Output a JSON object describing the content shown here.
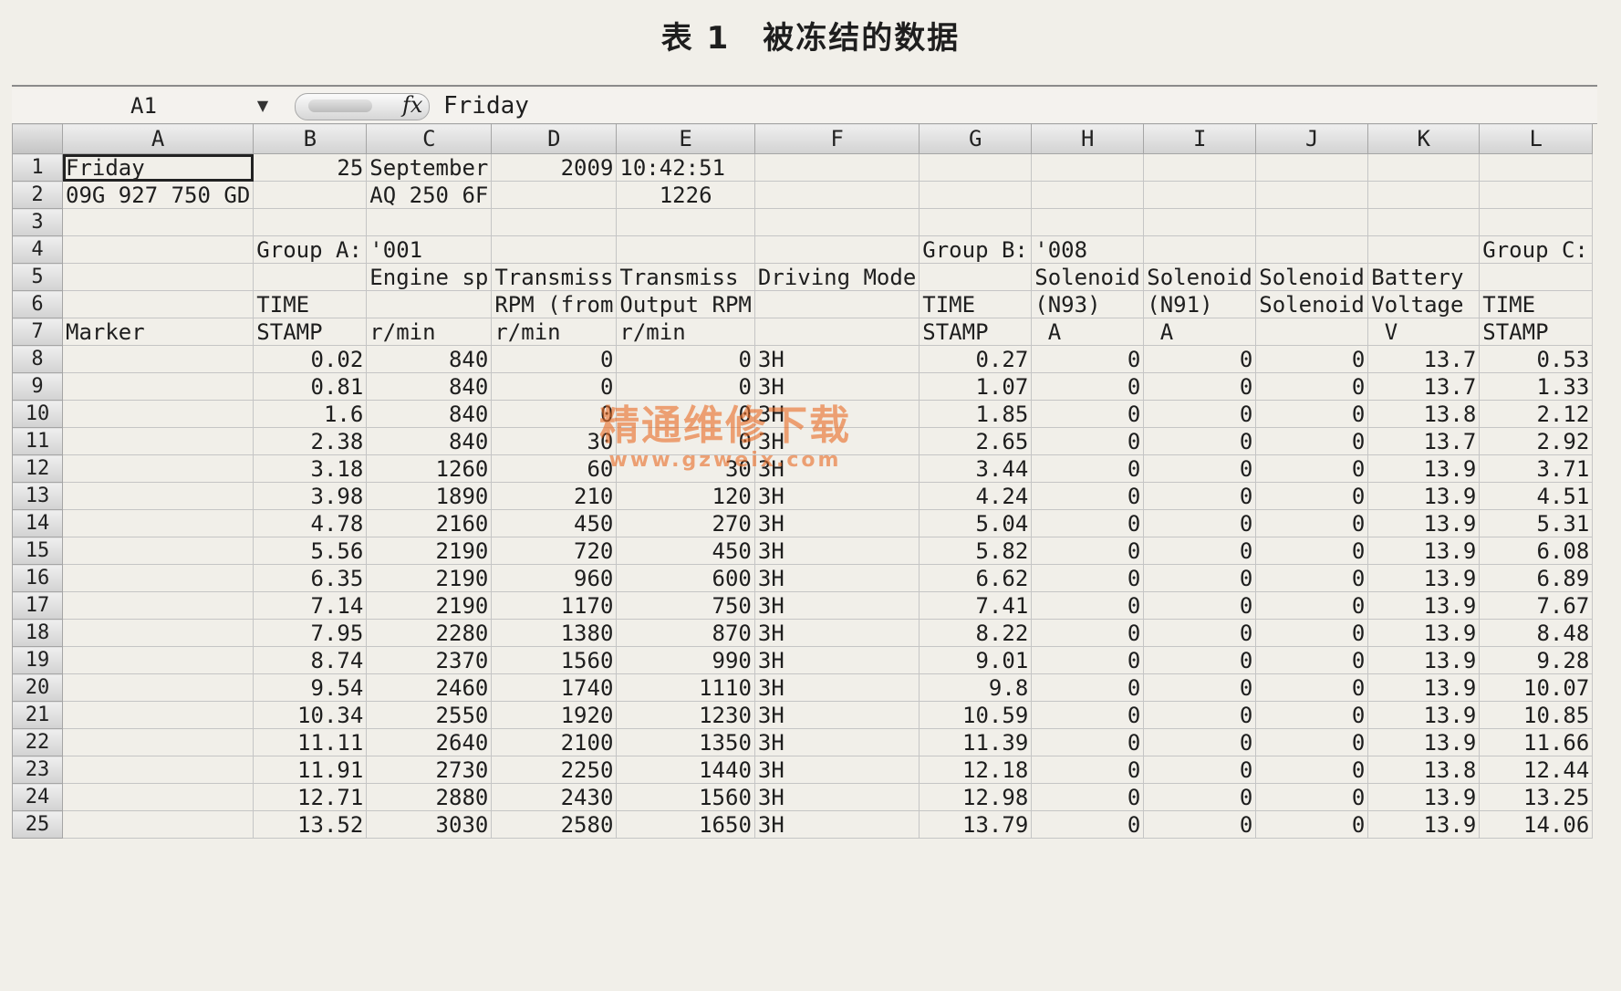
{
  "page_title": "表 1　被冻结的数据",
  "formula_bar": {
    "name_box": "A1",
    "fx_label": "fx",
    "value": "Friday"
  },
  "columns": [
    "A",
    "B",
    "C",
    "D",
    "E",
    "F",
    "G",
    "H",
    "I",
    "J",
    "K",
    "L"
  ],
  "rows": [
    {
      "n": "1",
      "c": [
        {
          "v": "Friday",
          "a": "l",
          "active": true
        },
        {
          "v": "25",
          "a": "r"
        },
        {
          "v": "September",
          "a": "l"
        },
        {
          "v": "2009",
          "a": "r"
        },
        {
          "v": "10:42:51",
          "a": "l"
        },
        {
          "v": ""
        },
        {
          "v": ""
        },
        {
          "v": ""
        },
        {
          "v": ""
        },
        {
          "v": ""
        },
        {
          "v": ""
        },
        {
          "v": ""
        }
      ]
    },
    {
      "n": "2",
      "c": [
        {
          "v": "09G 927 750 GD",
          "a": "l"
        },
        {
          "v": ""
        },
        {
          "v": "AQ 250 6F",
          "a": "l"
        },
        {
          "v": ""
        },
        {
          "v": "1226",
          "a": "c"
        },
        {
          "v": ""
        },
        {
          "v": ""
        },
        {
          "v": ""
        },
        {
          "v": ""
        },
        {
          "v": ""
        },
        {
          "v": ""
        },
        {
          "v": ""
        }
      ]
    },
    {
      "n": "3",
      "c": [
        {
          "v": ""
        },
        {
          "v": ""
        },
        {
          "v": ""
        },
        {
          "v": ""
        },
        {
          "v": ""
        },
        {
          "v": ""
        },
        {
          "v": ""
        },
        {
          "v": ""
        },
        {
          "v": ""
        },
        {
          "v": ""
        },
        {
          "v": ""
        },
        {
          "v": ""
        }
      ]
    },
    {
      "n": "4",
      "c": [
        {
          "v": ""
        },
        {
          "v": "Group A:",
          "a": "l"
        },
        {
          "v": "'001",
          "a": "l"
        },
        {
          "v": ""
        },
        {
          "v": ""
        },
        {
          "v": ""
        },
        {
          "v": "Group B:",
          "a": "l"
        },
        {
          "v": "'008",
          "a": "l"
        },
        {
          "v": ""
        },
        {
          "v": ""
        },
        {
          "v": ""
        },
        {
          "v": "Group C:",
          "a": "l"
        }
      ]
    },
    {
      "n": "5",
      "c": [
        {
          "v": ""
        },
        {
          "v": ""
        },
        {
          "v": "Engine sp",
          "a": "l"
        },
        {
          "v": "Transmiss",
          "a": "l"
        },
        {
          "v": "Transmiss",
          "a": "l"
        },
        {
          "v": "Driving Mode",
          "a": "l"
        },
        {
          "v": ""
        },
        {
          "v": "Solenoid",
          "a": "l"
        },
        {
          "v": "Solenoid",
          "a": "l"
        },
        {
          "v": "Solenoid",
          "a": "l"
        },
        {
          "v": "Battery",
          "a": "l"
        },
        {
          "v": ""
        }
      ]
    },
    {
      "n": "6",
      "c": [
        {
          "v": ""
        },
        {
          "v": "TIME",
          "a": "l"
        },
        {
          "v": ""
        },
        {
          "v": "RPM (from",
          "a": "l"
        },
        {
          "v": "Output RPM",
          "a": "l"
        },
        {
          "v": ""
        },
        {
          "v": "TIME",
          "a": "l"
        },
        {
          "v": "(N93)",
          "a": "l"
        },
        {
          "v": "(N91)",
          "a": "l"
        },
        {
          "v": "Solenoid",
          "a": "l"
        },
        {
          "v": "Voltage",
          "a": "l"
        },
        {
          "v": "TIME",
          "a": "l"
        }
      ]
    },
    {
      "n": "7",
      "c": [
        {
          "v": "Marker",
          "a": "l"
        },
        {
          "v": "STAMP",
          "a": "l"
        },
        {
          "v": "r/min",
          "a": "l"
        },
        {
          "v": "r/min",
          "a": "l"
        },
        {
          "v": "r/min",
          "a": "l"
        },
        {
          "v": ""
        },
        {
          "v": "STAMP",
          "a": "l"
        },
        {
          "v": " A",
          "a": "l"
        },
        {
          "v": " A",
          "a": "l"
        },
        {
          "v": ""
        },
        {
          "v": " V",
          "a": "l"
        },
        {
          "v": "STAMP",
          "a": "l"
        }
      ]
    },
    {
      "n": "8",
      "c": [
        {
          "v": ""
        },
        {
          "v": "0.02",
          "a": "r"
        },
        {
          "v": "840",
          "a": "r"
        },
        {
          "v": "0",
          "a": "r"
        },
        {
          "v": "0",
          "a": "r"
        },
        {
          "v": "3H",
          "a": "l"
        },
        {
          "v": "0.27",
          "a": "r"
        },
        {
          "v": "0",
          "a": "r"
        },
        {
          "v": "0",
          "a": "r"
        },
        {
          "v": "0",
          "a": "r"
        },
        {
          "v": "13.7",
          "a": "r"
        },
        {
          "v": "0.53",
          "a": "r"
        }
      ]
    },
    {
      "n": "9",
      "c": [
        {
          "v": ""
        },
        {
          "v": "0.81",
          "a": "r"
        },
        {
          "v": "840",
          "a": "r"
        },
        {
          "v": "0",
          "a": "r"
        },
        {
          "v": "0",
          "a": "r"
        },
        {
          "v": "3H",
          "a": "l"
        },
        {
          "v": "1.07",
          "a": "r"
        },
        {
          "v": "0",
          "a": "r"
        },
        {
          "v": "0",
          "a": "r"
        },
        {
          "v": "0",
          "a": "r"
        },
        {
          "v": "13.7",
          "a": "r"
        },
        {
          "v": "1.33",
          "a": "r"
        }
      ]
    },
    {
      "n": "10",
      "c": [
        {
          "v": ""
        },
        {
          "v": "1.6",
          "a": "r"
        },
        {
          "v": "840",
          "a": "r"
        },
        {
          "v": "0",
          "a": "r"
        },
        {
          "v": "0",
          "a": "r"
        },
        {
          "v": "3H",
          "a": "l"
        },
        {
          "v": "1.85",
          "a": "r"
        },
        {
          "v": "0",
          "a": "r"
        },
        {
          "v": "0",
          "a": "r"
        },
        {
          "v": "0",
          "a": "r"
        },
        {
          "v": "13.8",
          "a": "r"
        },
        {
          "v": "2.12",
          "a": "r"
        }
      ]
    },
    {
      "n": "11",
      "c": [
        {
          "v": ""
        },
        {
          "v": "2.38",
          "a": "r"
        },
        {
          "v": "840",
          "a": "r"
        },
        {
          "v": "30",
          "a": "r"
        },
        {
          "v": "0",
          "a": "r"
        },
        {
          "v": "3H",
          "a": "l"
        },
        {
          "v": "2.65",
          "a": "r"
        },
        {
          "v": "0",
          "a": "r"
        },
        {
          "v": "0",
          "a": "r"
        },
        {
          "v": "0",
          "a": "r"
        },
        {
          "v": "13.7",
          "a": "r"
        },
        {
          "v": "2.92",
          "a": "r"
        }
      ]
    },
    {
      "n": "12",
      "c": [
        {
          "v": ""
        },
        {
          "v": "3.18",
          "a": "r"
        },
        {
          "v": "1260",
          "a": "r"
        },
        {
          "v": "60",
          "a": "r"
        },
        {
          "v": "30",
          "a": "r"
        },
        {
          "v": "3H",
          "a": "l"
        },
        {
          "v": "3.44",
          "a": "r"
        },
        {
          "v": "0",
          "a": "r"
        },
        {
          "v": "0",
          "a": "r"
        },
        {
          "v": "0",
          "a": "r"
        },
        {
          "v": "13.9",
          "a": "r"
        },
        {
          "v": "3.71",
          "a": "r"
        }
      ]
    },
    {
      "n": "13",
      "c": [
        {
          "v": ""
        },
        {
          "v": "3.98",
          "a": "r"
        },
        {
          "v": "1890",
          "a": "r"
        },
        {
          "v": "210",
          "a": "r"
        },
        {
          "v": "120",
          "a": "r"
        },
        {
          "v": "3H",
          "a": "l"
        },
        {
          "v": "4.24",
          "a": "r"
        },
        {
          "v": "0",
          "a": "r"
        },
        {
          "v": "0",
          "a": "r"
        },
        {
          "v": "0",
          "a": "r"
        },
        {
          "v": "13.9",
          "a": "r"
        },
        {
          "v": "4.51",
          "a": "r"
        }
      ]
    },
    {
      "n": "14",
      "c": [
        {
          "v": ""
        },
        {
          "v": "4.78",
          "a": "r"
        },
        {
          "v": "2160",
          "a": "r"
        },
        {
          "v": "450",
          "a": "r"
        },
        {
          "v": "270",
          "a": "r"
        },
        {
          "v": "3H",
          "a": "l"
        },
        {
          "v": "5.04",
          "a": "r"
        },
        {
          "v": "0",
          "a": "r"
        },
        {
          "v": "0",
          "a": "r"
        },
        {
          "v": "0",
          "a": "r"
        },
        {
          "v": "13.9",
          "a": "r"
        },
        {
          "v": "5.31",
          "a": "r"
        }
      ]
    },
    {
      "n": "15",
      "c": [
        {
          "v": ""
        },
        {
          "v": "5.56",
          "a": "r"
        },
        {
          "v": "2190",
          "a": "r"
        },
        {
          "v": "720",
          "a": "r"
        },
        {
          "v": "450",
          "a": "r"
        },
        {
          "v": "3H",
          "a": "l"
        },
        {
          "v": "5.82",
          "a": "r"
        },
        {
          "v": "0",
          "a": "r"
        },
        {
          "v": "0",
          "a": "r"
        },
        {
          "v": "0",
          "a": "r"
        },
        {
          "v": "13.9",
          "a": "r"
        },
        {
          "v": "6.08",
          "a": "r"
        }
      ]
    },
    {
      "n": "16",
      "c": [
        {
          "v": ""
        },
        {
          "v": "6.35",
          "a": "r"
        },
        {
          "v": "2190",
          "a": "r"
        },
        {
          "v": "960",
          "a": "r"
        },
        {
          "v": "600",
          "a": "r"
        },
        {
          "v": "3H",
          "a": "l"
        },
        {
          "v": "6.62",
          "a": "r"
        },
        {
          "v": "0",
          "a": "r"
        },
        {
          "v": "0",
          "a": "r"
        },
        {
          "v": "0",
          "a": "r"
        },
        {
          "v": "13.9",
          "a": "r"
        },
        {
          "v": "6.89",
          "a": "r"
        }
      ]
    },
    {
      "n": "17",
      "c": [
        {
          "v": ""
        },
        {
          "v": "7.14",
          "a": "r"
        },
        {
          "v": "2190",
          "a": "r"
        },
        {
          "v": "1170",
          "a": "r"
        },
        {
          "v": "750",
          "a": "r"
        },
        {
          "v": "3H",
          "a": "l"
        },
        {
          "v": "7.41",
          "a": "r"
        },
        {
          "v": "0",
          "a": "r"
        },
        {
          "v": "0",
          "a": "r"
        },
        {
          "v": "0",
          "a": "r"
        },
        {
          "v": "13.9",
          "a": "r"
        },
        {
          "v": "7.67",
          "a": "r"
        }
      ]
    },
    {
      "n": "18",
      "c": [
        {
          "v": ""
        },
        {
          "v": "7.95",
          "a": "r"
        },
        {
          "v": "2280",
          "a": "r"
        },
        {
          "v": "1380",
          "a": "r"
        },
        {
          "v": "870",
          "a": "r"
        },
        {
          "v": "3H",
          "a": "l"
        },
        {
          "v": "8.22",
          "a": "r"
        },
        {
          "v": "0",
          "a": "r"
        },
        {
          "v": "0",
          "a": "r"
        },
        {
          "v": "0",
          "a": "r"
        },
        {
          "v": "13.9",
          "a": "r"
        },
        {
          "v": "8.48",
          "a": "r"
        }
      ]
    },
    {
      "n": "19",
      "c": [
        {
          "v": ""
        },
        {
          "v": "8.74",
          "a": "r"
        },
        {
          "v": "2370",
          "a": "r"
        },
        {
          "v": "1560",
          "a": "r"
        },
        {
          "v": "990",
          "a": "r"
        },
        {
          "v": "3H",
          "a": "l"
        },
        {
          "v": "9.01",
          "a": "r"
        },
        {
          "v": "0",
          "a": "r"
        },
        {
          "v": "0",
          "a": "r"
        },
        {
          "v": "0",
          "a": "r"
        },
        {
          "v": "13.9",
          "a": "r"
        },
        {
          "v": "9.28",
          "a": "r"
        }
      ]
    },
    {
      "n": "20",
      "c": [
        {
          "v": ""
        },
        {
          "v": "9.54",
          "a": "r"
        },
        {
          "v": "2460",
          "a": "r"
        },
        {
          "v": "1740",
          "a": "r"
        },
        {
          "v": "1110",
          "a": "r"
        },
        {
          "v": "3H",
          "a": "l"
        },
        {
          "v": "9.8",
          "a": "r"
        },
        {
          "v": "0",
          "a": "r"
        },
        {
          "v": "0",
          "a": "r"
        },
        {
          "v": "0",
          "a": "r"
        },
        {
          "v": "13.9",
          "a": "r"
        },
        {
          "v": "10.07",
          "a": "r"
        }
      ]
    },
    {
      "n": "21",
      "c": [
        {
          "v": ""
        },
        {
          "v": "10.34",
          "a": "r"
        },
        {
          "v": "2550",
          "a": "r"
        },
        {
          "v": "1920",
          "a": "r"
        },
        {
          "v": "1230",
          "a": "r"
        },
        {
          "v": "3H",
          "a": "l"
        },
        {
          "v": "10.59",
          "a": "r"
        },
        {
          "v": "0",
          "a": "r"
        },
        {
          "v": "0",
          "a": "r"
        },
        {
          "v": "0",
          "a": "r"
        },
        {
          "v": "13.9",
          "a": "r"
        },
        {
          "v": "10.85",
          "a": "r"
        }
      ]
    },
    {
      "n": "22",
      "c": [
        {
          "v": ""
        },
        {
          "v": "11.11",
          "a": "r"
        },
        {
          "v": "2640",
          "a": "r"
        },
        {
          "v": "2100",
          "a": "r"
        },
        {
          "v": "1350",
          "a": "r"
        },
        {
          "v": "3H",
          "a": "l"
        },
        {
          "v": "11.39",
          "a": "r"
        },
        {
          "v": "0",
          "a": "r"
        },
        {
          "v": "0",
          "a": "r"
        },
        {
          "v": "0",
          "a": "r"
        },
        {
          "v": "13.9",
          "a": "r"
        },
        {
          "v": "11.66",
          "a": "r"
        }
      ]
    },
    {
      "n": "23",
      "c": [
        {
          "v": ""
        },
        {
          "v": "11.91",
          "a": "r"
        },
        {
          "v": "2730",
          "a": "r"
        },
        {
          "v": "2250",
          "a": "r"
        },
        {
          "v": "1440",
          "a": "r"
        },
        {
          "v": "3H",
          "a": "l"
        },
        {
          "v": "12.18",
          "a": "r"
        },
        {
          "v": "0",
          "a": "r"
        },
        {
          "v": "0",
          "a": "r"
        },
        {
          "v": "0",
          "a": "r"
        },
        {
          "v": "13.8",
          "a": "r"
        },
        {
          "v": "12.44",
          "a": "r"
        }
      ]
    },
    {
      "n": "24",
      "c": [
        {
          "v": ""
        },
        {
          "v": "12.71",
          "a": "r"
        },
        {
          "v": "2880",
          "a": "r"
        },
        {
          "v": "2430",
          "a": "r"
        },
        {
          "v": "1560",
          "a": "r"
        },
        {
          "v": "3H",
          "a": "l"
        },
        {
          "v": "12.98",
          "a": "r"
        },
        {
          "v": "0",
          "a": "r"
        },
        {
          "v": "0",
          "a": "r"
        },
        {
          "v": "0",
          "a": "r"
        },
        {
          "v": "13.9",
          "a": "r"
        },
        {
          "v": "13.25",
          "a": "r"
        }
      ]
    },
    {
      "n": "25",
      "c": [
        {
          "v": ""
        },
        {
          "v": "13.52",
          "a": "r"
        },
        {
          "v": "3030",
          "a": "r"
        },
        {
          "v": "2580",
          "a": "r"
        },
        {
          "v": "1650",
          "a": "r"
        },
        {
          "v": "3H",
          "a": "l"
        },
        {
          "v": "13.79",
          "a": "r"
        },
        {
          "v": "0",
          "a": "r"
        },
        {
          "v": "0",
          "a": "r"
        },
        {
          "v": "0",
          "a": "r"
        },
        {
          "v": "13.9",
          "a": "r"
        },
        {
          "v": "14.06",
          "a": "r"
        }
      ]
    }
  ],
  "watermark": {
    "line1": "精通维修下载",
    "line2": "www.gzweix.com",
    "color": "#e86e28"
  }
}
